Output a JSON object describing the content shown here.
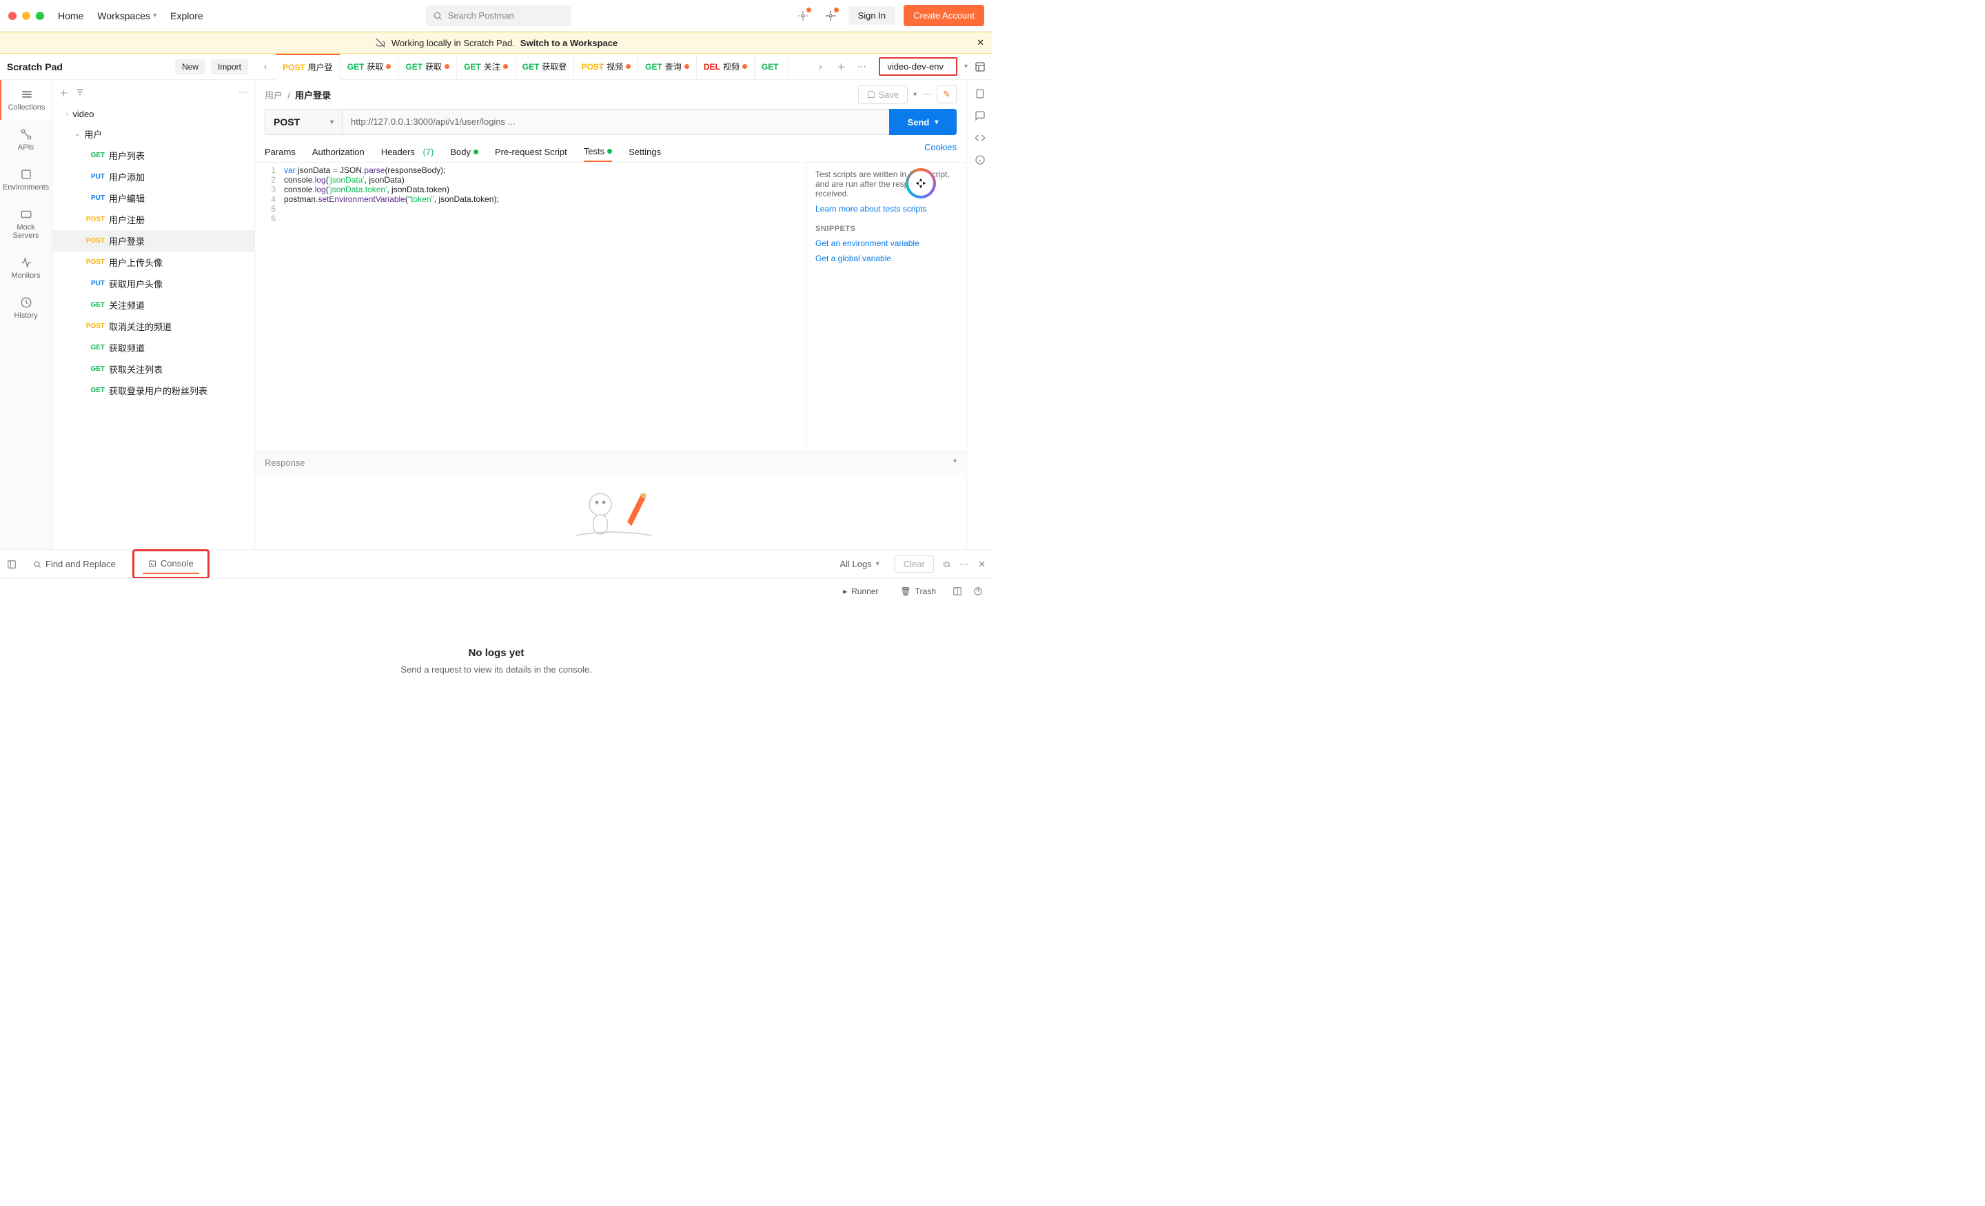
{
  "top": {
    "home": "Home",
    "workspaces": "Workspaces",
    "explore": "Explore",
    "search_placeholder": "Search Postman",
    "signin": "Sign In",
    "create": "Create Account"
  },
  "banner": {
    "text": "Working locally in Scratch Pad.",
    "link": "Switch to a Workspace"
  },
  "ws": {
    "title": "Scratch Pad",
    "new": "New",
    "import": "Import",
    "env": "video-dev-env"
  },
  "tabs": [
    {
      "method": "POST",
      "label": "用户登",
      "dirty": false,
      "active": true
    },
    {
      "method": "GET",
      "label": "获取",
      "dirty": true
    },
    {
      "method": "GET",
      "label": "获取",
      "dirty": true
    },
    {
      "method": "GET",
      "label": "关注",
      "dirty": true
    },
    {
      "method": "GET",
      "label": "获取登",
      "dirty": false
    },
    {
      "method": "POST",
      "label": "视频",
      "dirty": true
    },
    {
      "method": "GET",
      "label": "查询",
      "dirty": true
    },
    {
      "method": "DEL",
      "label": "视频",
      "dirty": true
    },
    {
      "method": "GET",
      "label": "",
      "dirty": false
    }
  ],
  "rail": {
    "collections": "Collections",
    "apis": "APIs",
    "envs": "Environments",
    "mocks": "Mock Servers",
    "monitors": "Monitors",
    "history": "History"
  },
  "tree": {
    "root": "video",
    "folder": "用户",
    "items": [
      {
        "method": "GET",
        "label": "用户列表"
      },
      {
        "method": "PUT",
        "label": "用户添加"
      },
      {
        "method": "PUT",
        "label": "用户编辑"
      },
      {
        "method": "POST",
        "label": "用户注册"
      },
      {
        "method": "POST",
        "label": "用户登录",
        "active": true
      },
      {
        "method": "POST",
        "label": "用户上传头像"
      },
      {
        "method": "PUT",
        "label": "获取用户头像"
      },
      {
        "method": "GET",
        "label": "关注频道"
      },
      {
        "method": "POST",
        "label": "取消关注的频道"
      },
      {
        "method": "GET",
        "label": "获取频道"
      },
      {
        "method": "GET",
        "label": "获取关注列表"
      },
      {
        "method": "GET",
        "label": "获取登录用户的粉丝列表"
      }
    ]
  },
  "request": {
    "breadcrumb_parent": "用户",
    "breadcrumb_current": "用户登录",
    "save": "Save",
    "method": "POST",
    "url": "http://127.0.0.1:3000/api/v1/user/logins ...",
    "send": "Send",
    "tabs": {
      "params": "Params",
      "auth": "Authorization",
      "headers": "Headers",
      "headers_count": "(7)",
      "body": "Body",
      "prerequest": "Pre-request Script",
      "tests": "Tests",
      "settings": "Settings",
      "cookies": "Cookies"
    }
  },
  "code": {
    "l1a": "var",
    "l1b": " jsonData ",
    "l1c": "=",
    "l1d": " JSON",
    "l1e": ".",
    "l1f": "parse",
    "l1g": "(responseBody);",
    "l2a": "console",
    "l2b": ".",
    "l2c": "log",
    "l2d": "(",
    "l2e": "'jsonData'",
    "l2f": ", jsonData)",
    "l3a": "console",
    "l3b": ".",
    "l3c": "log",
    "l3d": "(",
    "l3e": "'jsonData.token'",
    "l3f": ", jsonData.token)",
    "l4a": "postman",
    "l4b": ".",
    "l4c": "setEnvironmentVariable",
    "l4d": "(",
    "l4e": "\"token\"",
    "l4f": ", jsonData.token);"
  },
  "snippets": {
    "desc": "Test scripts are written in JavaScript, and are run after the response is received.",
    "learn": "Learn more about tests scripts",
    "hdr": "SNIPPETS",
    "s1": "Get an environment variable",
    "s2": "Get a global variable"
  },
  "response": {
    "label": "Response"
  },
  "footer": {
    "find": "Find and Replace",
    "console": "Console",
    "all_logs": "All Logs",
    "clear": "Clear"
  },
  "console": {
    "title": "No logs yet",
    "sub": "Send a request to view its details in the console."
  },
  "status": {
    "runner": "Runner",
    "trash": "Trash"
  }
}
